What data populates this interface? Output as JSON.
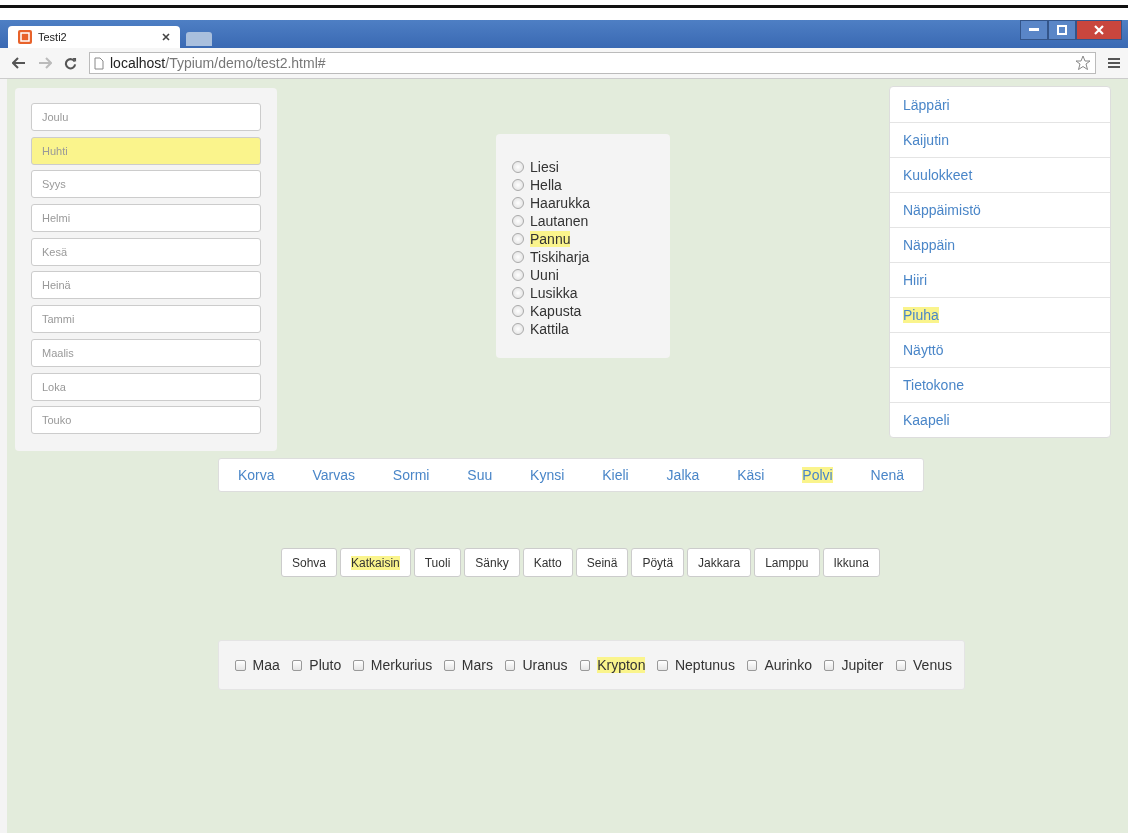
{
  "browser": {
    "tab_title": "Testi2",
    "url_host": "localhost",
    "url_path": "/Typium/demo/test2.html#"
  },
  "month_fields": [
    {
      "placeholder": "Joulu",
      "highlighted": false
    },
    {
      "placeholder": "Huhti",
      "highlighted": true
    },
    {
      "placeholder": "Syys",
      "highlighted": false
    },
    {
      "placeholder": "Helmi",
      "highlighted": false
    },
    {
      "placeholder": "Kesä",
      "highlighted": false
    },
    {
      "placeholder": "Heinä",
      "highlighted": false
    },
    {
      "placeholder": "Tammi",
      "highlighted": false
    },
    {
      "placeholder": "Maalis",
      "highlighted": false
    },
    {
      "placeholder": "Loka",
      "highlighted": false
    },
    {
      "placeholder": "Touko",
      "highlighted": false
    }
  ],
  "radio_options": [
    {
      "label": "Liesi",
      "highlighted": false,
      "selected": false
    },
    {
      "label": "Hella",
      "highlighted": false,
      "selected": false
    },
    {
      "label": "Haarukka",
      "highlighted": false,
      "selected": false
    },
    {
      "label": "Lautanen",
      "highlighted": false,
      "selected": false
    },
    {
      "label": "Pannu",
      "highlighted": true,
      "selected": false
    },
    {
      "label": "Tiskiharja",
      "highlighted": false,
      "selected": false
    },
    {
      "label": "Uuni",
      "highlighted": false,
      "selected": false
    },
    {
      "label": "Lusikka",
      "highlighted": false,
      "selected": false
    },
    {
      "label": "Kapusta",
      "highlighted": false,
      "selected": false
    },
    {
      "label": "Kattila",
      "highlighted": false,
      "selected": false
    }
  ],
  "list_links": [
    {
      "label": "Läppäri",
      "highlighted": false
    },
    {
      "label": "Kaijutin",
      "highlighted": false
    },
    {
      "label": "Kuulokkeet",
      "highlighted": false
    },
    {
      "label": "Näppäimistö",
      "highlighted": false
    },
    {
      "label": "Näppäin",
      "highlighted": false
    },
    {
      "label": "Hiiri",
      "highlighted": false
    },
    {
      "label": "Piuha",
      "highlighted": true
    },
    {
      "label": "Näyttö",
      "highlighted": false
    },
    {
      "label": "Tietokone",
      "highlighted": false
    },
    {
      "label": "Kaapeli",
      "highlighted": false
    }
  ],
  "nav_links": [
    {
      "label": "Korva",
      "highlighted": false
    },
    {
      "label": "Varvas",
      "highlighted": false
    },
    {
      "label": "Sormi",
      "highlighted": false
    },
    {
      "label": "Suu",
      "highlighted": false
    },
    {
      "label": "Kynsi",
      "highlighted": false
    },
    {
      "label": "Kieli",
      "highlighted": false
    },
    {
      "label": "Jalka",
      "highlighted": false
    },
    {
      "label": "Käsi",
      "highlighted": false
    },
    {
      "label": "Polvi",
      "highlighted": true
    },
    {
      "label": "Nenä",
      "highlighted": false
    }
  ],
  "buttons": [
    {
      "label": "Sohva",
      "highlighted": false
    },
    {
      "label": "Katkaisin",
      "highlighted": true
    },
    {
      "label": "Tuoli",
      "highlighted": false
    },
    {
      "label": "Sänky",
      "highlighted": false
    },
    {
      "label": "Katto",
      "highlighted": false
    },
    {
      "label": "Seinä",
      "highlighted": false
    },
    {
      "label": "Pöytä",
      "highlighted": false
    },
    {
      "label": "Jakkara",
      "highlighted": false
    },
    {
      "label": "Lamppu",
      "highlighted": false
    },
    {
      "label": "Ikkuna",
      "highlighted": false
    }
  ],
  "checkboxes": [
    {
      "label": "Maa",
      "highlighted": false,
      "checked": false
    },
    {
      "label": "Pluto",
      "highlighted": false,
      "checked": false
    },
    {
      "label": "Merkurius",
      "highlighted": false,
      "checked": false
    },
    {
      "label": "Mars",
      "highlighted": false,
      "checked": false
    },
    {
      "label": "Uranus",
      "highlighted": false,
      "checked": false
    },
    {
      "label": "Krypton",
      "highlighted": true,
      "checked": false
    },
    {
      "label": "Neptunus",
      "highlighted": false,
      "checked": false
    },
    {
      "label": "Aurinko",
      "highlighted": false,
      "checked": false
    },
    {
      "label": "Jupiter",
      "highlighted": false,
      "checked": false
    },
    {
      "label": "Venus",
      "highlighted": false,
      "checked": false
    }
  ]
}
